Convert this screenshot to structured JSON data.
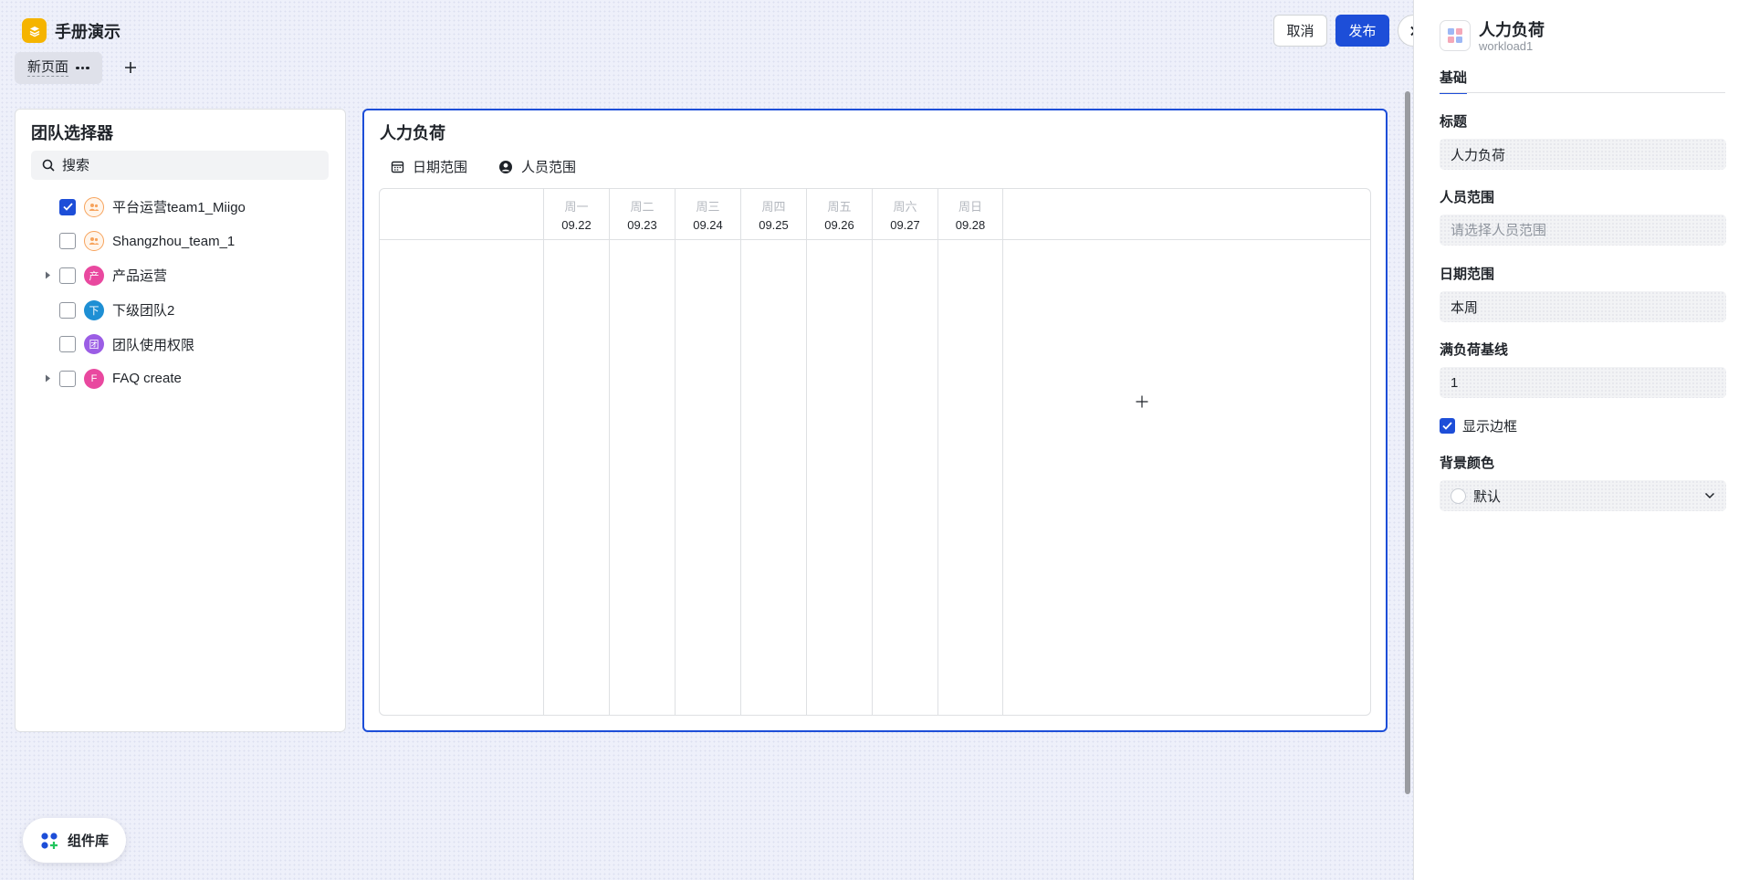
{
  "app": {
    "title": "手册演示",
    "page_tab": "新页面",
    "cancel_label": "取消",
    "publish_label": "发布"
  },
  "team_selector": {
    "title": "团队选择器",
    "search_placeholder": "搜索",
    "items": [
      {
        "name": "平台运营team1_Miigo",
        "checked": true,
        "expandable": false,
        "avatar": "people-icon",
        "avatar_color": "#f7a35c"
      },
      {
        "name": "Shangzhou_team_1",
        "checked": false,
        "expandable": false,
        "avatar": "people-icon",
        "avatar_color": "#f7a35c"
      },
      {
        "name": "产品运营",
        "checked": false,
        "expandable": true,
        "avatar_text": "产",
        "avatar_color": "#e9489f"
      },
      {
        "name": "下级团队2",
        "checked": false,
        "expandable": false,
        "avatar_text": "下",
        "avatar_color": "#1e8fd4"
      },
      {
        "name": "团队使用权限",
        "checked": false,
        "expandable": false,
        "avatar_text": "团",
        "avatar_color": "#9b5de5"
      },
      {
        "name": "FAQ create",
        "checked": false,
        "expandable": true,
        "avatar_text": "F",
        "avatar_color": "#e9489f"
      }
    ]
  },
  "workload": {
    "title": "人力负荷",
    "filters": {
      "date_range": "日期范围",
      "people_range": "人员范围"
    },
    "days": [
      {
        "weekday": "周一",
        "date": "09.22"
      },
      {
        "weekday": "周二",
        "date": "09.23"
      },
      {
        "weekday": "周三",
        "date": "09.24"
      },
      {
        "weekday": "周四",
        "date": "09.25"
      },
      {
        "weekday": "周五",
        "date": "09.26"
      },
      {
        "weekday": "周六",
        "date": "09.27"
      },
      {
        "weekday": "周日",
        "date": "09.28"
      }
    ]
  },
  "component_library": {
    "label": "组件库"
  },
  "panel": {
    "title": "人力负荷",
    "subtitle": "workload1",
    "tab": "基础",
    "fields": {
      "title_label": "标题",
      "title_value": "人力负荷",
      "people_label": "人员范围",
      "people_placeholder": "请选择人员范围",
      "date_label": "日期范围",
      "date_value": "本周",
      "baseline_label": "满负荷基线",
      "baseline_value": "1",
      "border_label": "显示边框",
      "border_checked": true,
      "bg_label": "背景颜色",
      "bg_value": "默认"
    }
  },
  "colors": {
    "accent": "#1d4ed8",
    "logo": "#f5b400"
  }
}
